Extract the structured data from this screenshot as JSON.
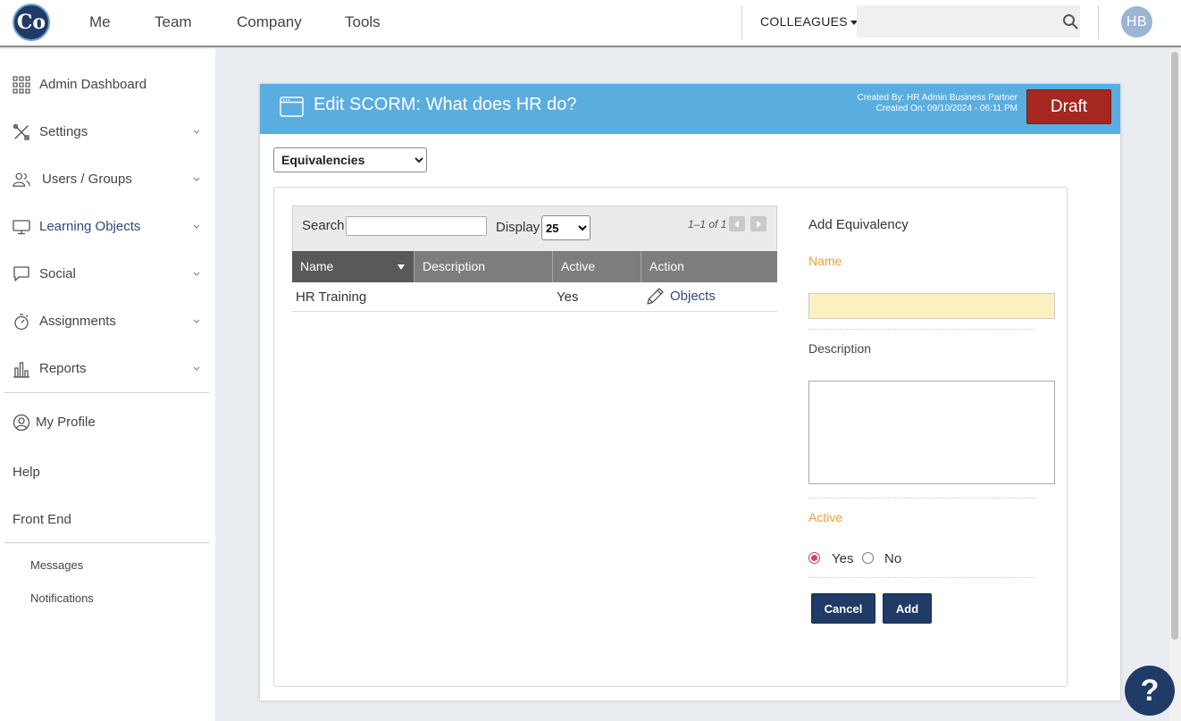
{
  "topbar": {
    "logo_text": "Co",
    "nav": [
      "Me",
      "Team",
      "Company",
      "Tools"
    ],
    "colleagues_label": "COLLEAGUES",
    "search_placeholder": "",
    "avatar_initials": "HB"
  },
  "sidebar": {
    "items": [
      {
        "label": "Admin Dashboard",
        "icon": "grid-icon"
      },
      {
        "label": "Settings",
        "icon": "tools-icon"
      },
      {
        "label": "Users / Groups",
        "icon": "users-icon"
      },
      {
        "label": "Learning Objects",
        "icon": "monitor-icon"
      },
      {
        "label": "Social",
        "icon": "chat-icon"
      },
      {
        "label": "Assignments",
        "icon": "stopwatch-icon"
      },
      {
        "label": "Reports",
        "icon": "bar-chart-icon"
      }
    ],
    "my_profile": "My Profile",
    "help": "Help",
    "front_end": "Front End",
    "messages": "Messages",
    "notifications": "Notifications"
  },
  "panel": {
    "title": "Edit SCORM: What does HR do?",
    "created_by": "Created By: HR Admin Business Partner",
    "created_on": "Created On: 09/10/2024 - 06:11 PM",
    "status_button": "Draft",
    "view_select": "Equivalencies"
  },
  "table": {
    "search_label": "Search",
    "search_value": "",
    "display_label": "Display",
    "display_value": "25",
    "pager_text": "1–1 of 1",
    "columns": [
      "Name",
      "Description",
      "Active",
      "Action"
    ],
    "rows": [
      {
        "name": "HR Training",
        "description": "",
        "active": "Yes",
        "action": "Objects"
      }
    ]
  },
  "form": {
    "title": "Add Equivalency",
    "name_label": "Name",
    "name_value": "",
    "description_label": "Description",
    "description_value": "",
    "active_label": "Active",
    "yes_label": "Yes",
    "no_label": "No",
    "active_value": "Yes",
    "cancel_label": "Cancel",
    "add_label": "Add"
  },
  "help_label": "?",
  "colors": {
    "header_blue": "#5aaddf",
    "draft_red": "#a52720",
    "navy": "#1f3b66",
    "orange_label": "#e8a03a"
  }
}
